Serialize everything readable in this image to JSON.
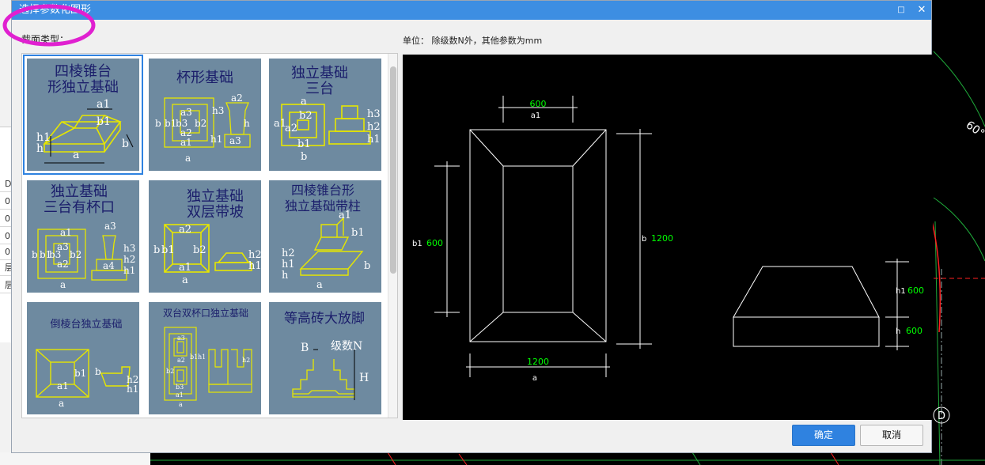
{
  "dialog": {
    "title": "选择参数化图形",
    "section_label": "截面类型：",
    "unit_label": "单位：  除级数N外，其他参数为mm",
    "ok_label": "确定",
    "cancel_label": "取消",
    "maximize_icon": "maximize-icon",
    "close_icon": "close-icon"
  },
  "background": {
    "left_rows": [
      "D",
      "0",
      "0",
      "0",
      "0",
      "层",
      "层"
    ],
    "angle_label": "60°",
    "axis_label": "D"
  },
  "tiles": [
    {
      "title": "四棱锥台\n形独立基础",
      "selected": true
    },
    {
      "title": "杯形基础",
      "selected": false
    },
    {
      "title": "独立基础\n三台",
      "selected": false
    },
    {
      "title": "独立基础\n三台有杯口",
      "selected": false
    },
    {
      "title": "独立基础\n双层带坡",
      "selected": false
    },
    {
      "title": "四棱锥台形\n独立基础带柱",
      "selected": false
    },
    {
      "title": "倒棱台独立基础",
      "selected": false
    },
    {
      "title": "双台双杯口独立基础",
      "selected": false
    },
    {
      "title": "等高砖大放脚",
      "selected": false
    }
  ],
  "tile_labels": {
    "t1": [
      "a1",
      "b1",
      "h1",
      "h",
      "a",
      "b"
    ],
    "t2": [
      "a2",
      "h3",
      "b",
      "b1",
      "b3",
      "b2",
      "h",
      "a3",
      "a2",
      "a1",
      "h1",
      "a3",
      "a"
    ],
    "t3": [
      "b2",
      "a2",
      "a1",
      "a",
      "b1",
      "b",
      "h3",
      "h2",
      "h1"
    ],
    "t4": [
      "a1",
      "a3",
      "a2",
      "b",
      "b1",
      "b3",
      "b2",
      "a3",
      "a4",
      "h3",
      "h2",
      "h1",
      "a"
    ],
    "t5": [
      "a2",
      "b",
      "b1",
      "b2",
      "a1",
      "a",
      "h2",
      "h1"
    ],
    "t6": [
      "a1",
      "b1",
      "h2",
      "h1",
      "h",
      "b",
      "a"
    ],
    "t7": [
      "b1",
      "b",
      "a1",
      "a",
      "h2",
      "h1"
    ],
    "t8": [
      "a3",
      "a2",
      "b2",
      "b3",
      "b1",
      "h1",
      "h2",
      "a1",
      "a"
    ],
    "t9": [
      "B",
      "级数N",
      "H"
    ]
  },
  "preview": {
    "a1_value": "600",
    "a1_label": "a1",
    "b1_label": "b1",
    "b1_value": "600",
    "b_label": "b",
    "b_value": "1200",
    "a_value": "1200",
    "a_label": "a",
    "h1_label": "h1",
    "h1_value": "600",
    "h_label": "h",
    "h_value": "600"
  },
  "colors": {
    "titlebar": "#3d8ee2",
    "tile_bg": "#6e8aa0",
    "tile_title": "#1b1e6b",
    "line_yellow": "#e6e600",
    "preview_value": "#00ff00",
    "ok_button": "#2f82e0",
    "annotation": "#e020d0"
  }
}
